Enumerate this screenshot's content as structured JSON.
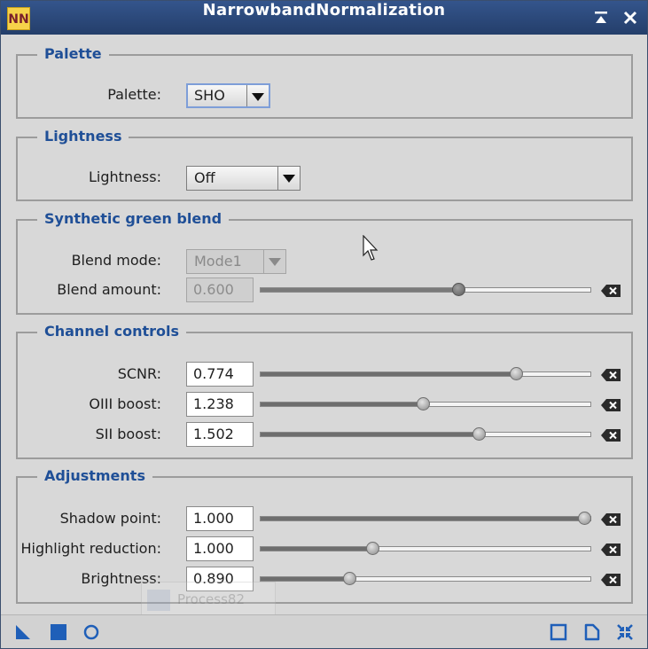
{
  "window": {
    "title": "NarrowbandNormalization",
    "icon_text": "NN"
  },
  "groups": {
    "palette": {
      "title": "Palette",
      "label": "Palette:",
      "value": "SHO"
    },
    "lightness": {
      "title": "Lightness",
      "label": "Lightness:",
      "value": "Off"
    },
    "synthetic": {
      "title": "Synthetic green blend",
      "blend_mode_label": "Blend mode:",
      "blend_mode_value": "Mode1",
      "blend_amount_label": "Blend amount:",
      "blend_amount_value": "0.600",
      "blend_amount_fraction": 0.6
    },
    "channel": {
      "title": "Channel controls",
      "rows": [
        {
          "label": "SCNR:",
          "value": "0.774",
          "fraction": 0.774
        },
        {
          "label": "OIII boost:",
          "value": "1.238",
          "fraction": 0.491
        },
        {
          "label": "SII boost:",
          "value": "1.502",
          "fraction": 0.661
        }
      ]
    },
    "adjustments": {
      "title": "Adjustments",
      "rows": [
        {
          "label": "Shadow point:",
          "value": "1.000",
          "fraction": 0.98
        },
        {
          "label": "Highlight reduction:",
          "value": "1.000",
          "fraction": 0.34
        },
        {
          "label": "Brightness:",
          "value": "0.890",
          "fraction": 0.27
        }
      ]
    }
  },
  "ghost_label": "Process82",
  "icons": {
    "titlebar": [
      "shade-icon",
      "close-icon"
    ],
    "bottombar_left": [
      "new-instance-icon",
      "apply-icon",
      "apply-global-icon"
    ],
    "bottombar_right": [
      "preview-icon",
      "documentation-icon",
      "reset-icon"
    ]
  },
  "colors": {
    "titlebar": "#2d4a7c",
    "group_title": "#1f4f97",
    "window_bg": "#d8d8d8",
    "bottom_icons": "#1f5fb8"
  }
}
